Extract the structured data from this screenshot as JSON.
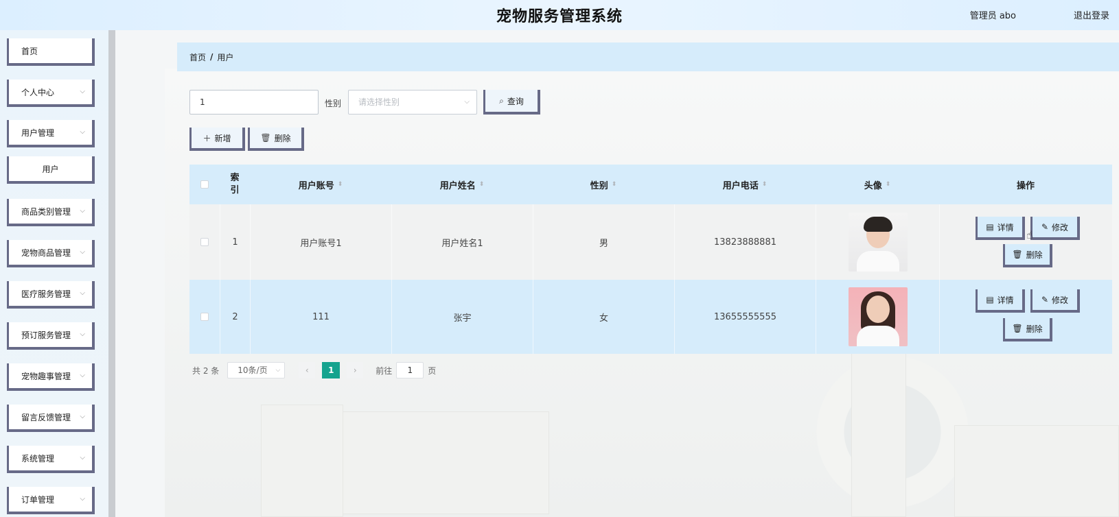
{
  "header": {
    "title": "宠物服务管理系统",
    "user": "管理员 abo",
    "logout": "退出登录"
  },
  "sidebar": {
    "items": [
      {
        "label": "首页",
        "chevron": false
      },
      {
        "label": "个人中心",
        "chevron": true
      },
      {
        "label": "用户管理",
        "chevron": true
      },
      {
        "label": "用户",
        "chevron": false,
        "sub": true
      },
      {
        "label": "商品类别管理",
        "chevron": true
      },
      {
        "label": "宠物商品管理",
        "chevron": true
      },
      {
        "label": "医疗服务管理",
        "chevron": true
      },
      {
        "label": "预订服务管理",
        "chevron": true
      },
      {
        "label": "宠物趣事管理",
        "chevron": true
      },
      {
        "label": "留言反馈管理",
        "chevron": true
      },
      {
        "label": "系统管理",
        "chevron": true
      },
      {
        "label": "订单管理",
        "chevron": true
      }
    ]
  },
  "breadcrumb": {
    "home": "首页",
    "separator": "/",
    "current": "用户"
  },
  "search": {
    "value": "1",
    "gender_label": "性别",
    "gender_placeholder": "请选择性别",
    "query_label": "查询"
  },
  "toolbar": {
    "add_label": "新增",
    "delete_label": "删除"
  },
  "table": {
    "headers": {
      "index": "索\n引",
      "account": "用户账号",
      "name": "用户姓名",
      "gender": "性别",
      "phone": "用户电话",
      "avatar": "头像",
      "actions": "操作"
    },
    "rows": [
      {
        "index": "1",
        "account": "用户账号1",
        "name": "用户姓名1",
        "gender": "男",
        "phone": "13823888881",
        "avatar": "male"
      },
      {
        "index": "2",
        "account": "111",
        "name": "张宇",
        "gender": "女",
        "phone": "13655555555",
        "avatar": "female"
      }
    ],
    "actions": {
      "detail": "详情",
      "edit": "修改",
      "delete": "删除"
    }
  },
  "pagination": {
    "total": "共 2 条",
    "page_size": "10条/页",
    "current_page": "1",
    "goto_label": "前往",
    "goto_value": "1",
    "page_suffix": "页"
  },
  "colors": {
    "accent": "#15a38e",
    "header_bg": "#dcefff",
    "row_highlight": "#d6ecfb",
    "button_border": "#676a87"
  }
}
